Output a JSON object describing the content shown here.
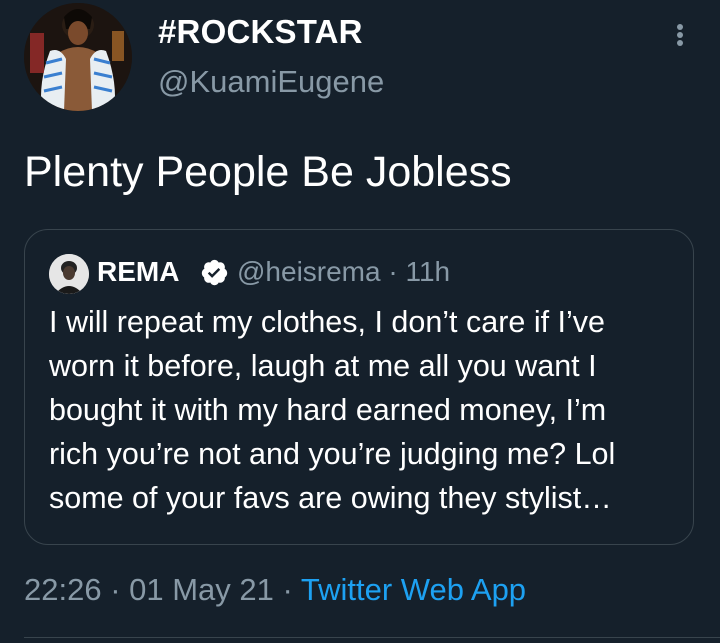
{
  "tweet": {
    "author": {
      "display_name": "#ROCKSTAR",
      "handle": "@KuamiEugene"
    },
    "text": "Plenty People Be Jobless",
    "more_icon": "more-vertical-icon",
    "quoted": {
      "display_name": "REMA",
      "verified_icon": "verified-badge-icon",
      "handle": "@heisrema",
      "separator": " · ",
      "time": "11h",
      "lines": [
        "I will repeat my clothes, I don’t care if I’ve",
        "worn it before, laugh at me all you want I",
        "bought it with my hard earned money, I’m",
        "rich you’re not and you’re judging me? Lol",
        "some of your favs are owing they stylist…"
      ]
    },
    "footer": {
      "time": "22:26",
      "sep1": " · ",
      "date": "01 May 21",
      "sep2": " · ",
      "app": "Twitter Web App"
    }
  },
  "colors": {
    "background": "#15202b",
    "secondary_text": "#8899a6",
    "accent": "#1da1f2",
    "border": "#38444d"
  }
}
